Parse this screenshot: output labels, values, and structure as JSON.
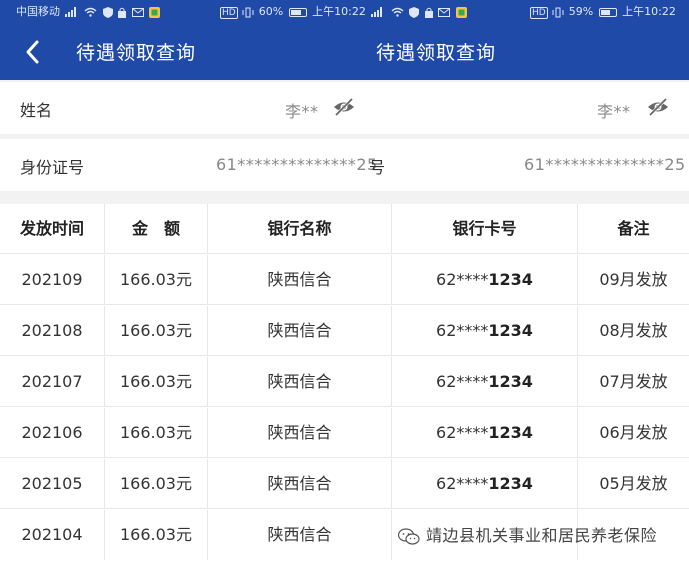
{
  "status_bar_left": {
    "carrier": "中国移动",
    "hd": "HD",
    "battery": "60%",
    "time": "上午10:22"
  },
  "status_bar_right": {
    "hd": "HD",
    "battery": "59%",
    "time": "上午10:22"
  },
  "header": {
    "title_left": "待遇领取查询",
    "title_right": "待遇领取查询"
  },
  "info": {
    "name_label": "姓名",
    "name_value_left": "李**",
    "name_value_right": "李**",
    "id_label": "身份证号",
    "id_value_left": "61**************25",
    "id_label_fragment": "号",
    "id_value_right": "61**************25"
  },
  "table": {
    "headers": [
      "发放时间",
      "金　额",
      "银行名称",
      "银行卡号",
      "备注"
    ],
    "rows": [
      {
        "date": "202109",
        "amount": "166.03元",
        "bank": "陕西信合",
        "card_prefix": "62****",
        "card_suffix": "1234",
        "note": "09月发放"
      },
      {
        "date": "202108",
        "amount": "166.03元",
        "bank": "陕西信合",
        "card_prefix": "62****",
        "card_suffix": "1234",
        "note": "08月发放"
      },
      {
        "date": "202107",
        "amount": "166.03元",
        "bank": "陕西信合",
        "card_prefix": "62****",
        "card_suffix": "1234",
        "note": "07月发放"
      },
      {
        "date": "202106",
        "amount": "166.03元",
        "bank": "陕西信合",
        "card_prefix": "62****",
        "card_suffix": "1234",
        "note": "06月发放"
      },
      {
        "date": "202105",
        "amount": "166.03元",
        "bank": "陕西信合",
        "card_prefix": "62****",
        "card_suffix": "1234",
        "note": "05月发放"
      },
      {
        "date": "202104",
        "amount": "166.03元",
        "bank": "陕西信合",
        "card_prefix": "",
        "card_suffix": "",
        "note": ""
      }
    ]
  },
  "watermark": {
    "text": "靖边县机关事业和居民养老保险"
  },
  "colors": {
    "header_bg": "#1f4aa8",
    "page_bg": "#f2f2f2",
    "row_bg": "#ffffff"
  },
  "icons": {
    "back": "chevron-left-icon",
    "visibility": "eye-off-icon",
    "wechat": "wechat-icon"
  }
}
